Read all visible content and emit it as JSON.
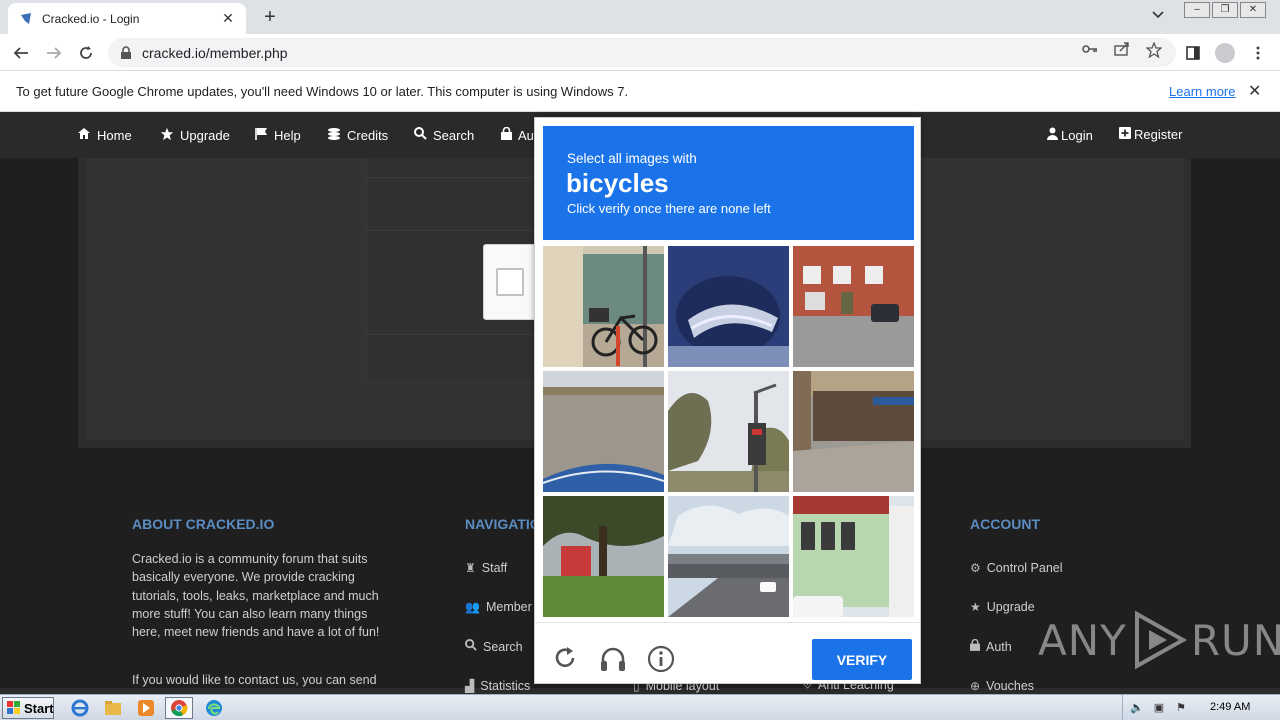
{
  "browser": {
    "tab_title": "Cracked.io - Login",
    "tab_close": "✕",
    "new_tab": "+",
    "url": "cracked.io/member.php",
    "infobar_text": "To get future Google Chrome updates, you'll need Windows 10 or later. This computer is using Windows 7.",
    "infobar_link": "Learn more",
    "infobar_close": "✕"
  },
  "site_nav": {
    "items": [
      {
        "label": "Home",
        "icon": "home-icon"
      },
      {
        "label": "Upgrade",
        "icon": "star-icon"
      },
      {
        "label": "Help",
        "icon": "flag-icon"
      },
      {
        "label": "Credits",
        "icon": "coins-icon"
      },
      {
        "label": "Search",
        "icon": "search-icon"
      },
      {
        "label": "Au",
        "icon": "lock-icon"
      }
    ],
    "right": [
      {
        "label": "Login",
        "icon": "user-icon"
      },
      {
        "label": "Register",
        "icon": "plus-square-icon"
      }
    ]
  },
  "footer": {
    "about_heading": "ABOUT CRACKED.IO",
    "about_text": "Cracked.io is a community forum that suits basically everyone. We provide cracking tutorials, tools, leaks, marketplace and much more stuff! You can also learn many things here, meet new friends and have a lot of fun!",
    "about_text2": "If you would like to contact us, you can send",
    "nav_heading": "NAVIGATIO",
    "nav_links": [
      "Staff",
      "Member",
      "Search",
      "Statistics"
    ],
    "mid_links": [
      "Mobile layout",
      "Anti Leaching"
    ],
    "account_heading": "ACCOUNT",
    "account_links": [
      "Control Panel",
      "Upgrade",
      "Auth",
      "Vouches"
    ]
  },
  "captcha": {
    "instruction": "Select all images with",
    "target": "bicycles",
    "subtext": "Click verify once there are none left",
    "verify_label": "VERIFY",
    "tiles": [
      "bicycle-on-sidewalk",
      "car-side-mirror",
      "brick-houses",
      "road-with-car-edge",
      "street-sign-pole",
      "roadside-building",
      "park-trees",
      "highway-overpass",
      "green-house"
    ]
  },
  "watermark": {
    "text_left": "ANY",
    "text_right": "RUN"
  },
  "taskbar": {
    "start_label": "Start",
    "clock": "2:49 AM"
  },
  "colors": {
    "accent": "#1a73e8",
    "footer_heading": "#5b8cc2",
    "site_nav_bg": "#2a2a2a"
  }
}
